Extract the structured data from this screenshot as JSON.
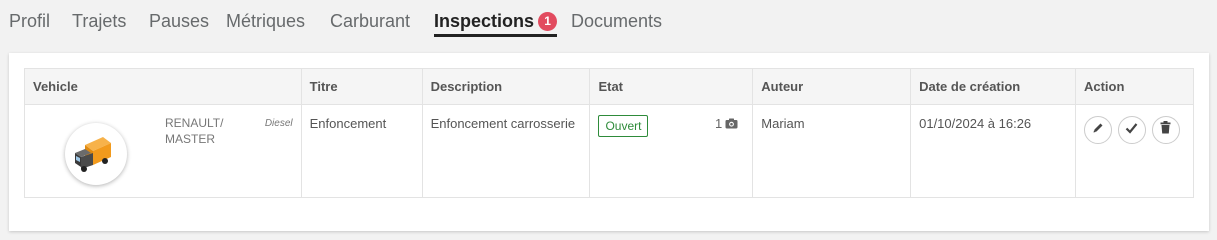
{
  "tabs": [
    {
      "label": "Profil"
    },
    {
      "label": "Trajets"
    },
    {
      "label": "Pauses"
    },
    {
      "label": "Métriques"
    },
    {
      "label": "Carburant"
    },
    {
      "label": "Inspections",
      "badge": "1",
      "active": true
    },
    {
      "label": "Documents"
    }
  ],
  "table": {
    "headers": [
      "Vehicle",
      "Titre",
      "Description",
      "Etat",
      "Auteur",
      "Date de création",
      "Action"
    ],
    "rows": [
      {
        "vehicle_name": "RENAULT/\nMASTER",
        "vehicle_fuel": "Diesel",
        "titre": "Enfoncement",
        "description": "Enfoncement carrosserie",
        "etat": "Ouvert",
        "photo_count": "1",
        "auteur": "Mariam",
        "date": "01/10/2024 à 16:26"
      }
    ]
  },
  "colors": {
    "badge": "#e24b5f",
    "status_open": "#2e8b3a",
    "vehicle_orange": "#f29a1c"
  },
  "icons": {
    "photo": "camera-icon",
    "edit": "pencil-icon",
    "validate": "check-icon",
    "delete": "trash-icon"
  }
}
